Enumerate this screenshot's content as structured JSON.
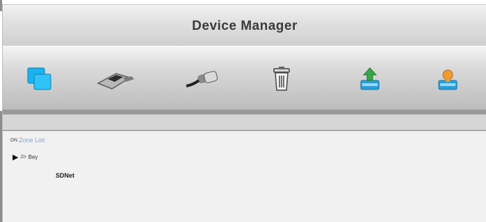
{
  "window": {
    "title": "Device Manager"
  },
  "toolbar": {
    "buttons": [
      {
        "name": "add-device",
        "icon": "windows-icon"
      },
      {
        "name": "edit-device",
        "icon": "eraser-icon"
      },
      {
        "name": "connect",
        "icon": "cable-icon"
      },
      {
        "name": "delete",
        "icon": "trash-icon"
      },
      {
        "name": "import",
        "icon": "import-icon"
      },
      {
        "name": "export",
        "icon": "export-icon"
      }
    ]
  },
  "tree": {
    "root_icon_text": "DN",
    "root_label": "Zone List",
    "child_icon_text": "Zn",
    "child_label": "Bey",
    "leaf_label": "SDNet"
  },
  "colors": {
    "accent": "#17a7e8",
    "green": "#3aa64b",
    "orange": "#f29a2e",
    "tree_blue": "#7fa6d2"
  }
}
